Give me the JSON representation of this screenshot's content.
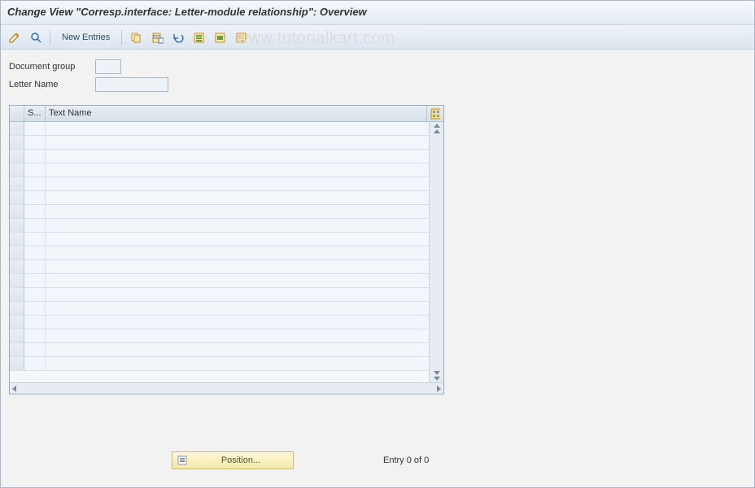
{
  "title": "Change View \"Corresp.interface: Letter-module relationship\": Overview",
  "watermark": "www.tutorialkart.com",
  "toolbar": {
    "new_entries": "New Entries"
  },
  "fields": {
    "doc_group_label": "Document group",
    "doc_group_value": "",
    "letter_name_label": "Letter Name",
    "letter_name_value": ""
  },
  "table": {
    "col_s": "S...",
    "col_textname": "Text Name",
    "rows": []
  },
  "footer": {
    "position_label": "Position...",
    "entry_text": "Entry 0 of 0"
  }
}
